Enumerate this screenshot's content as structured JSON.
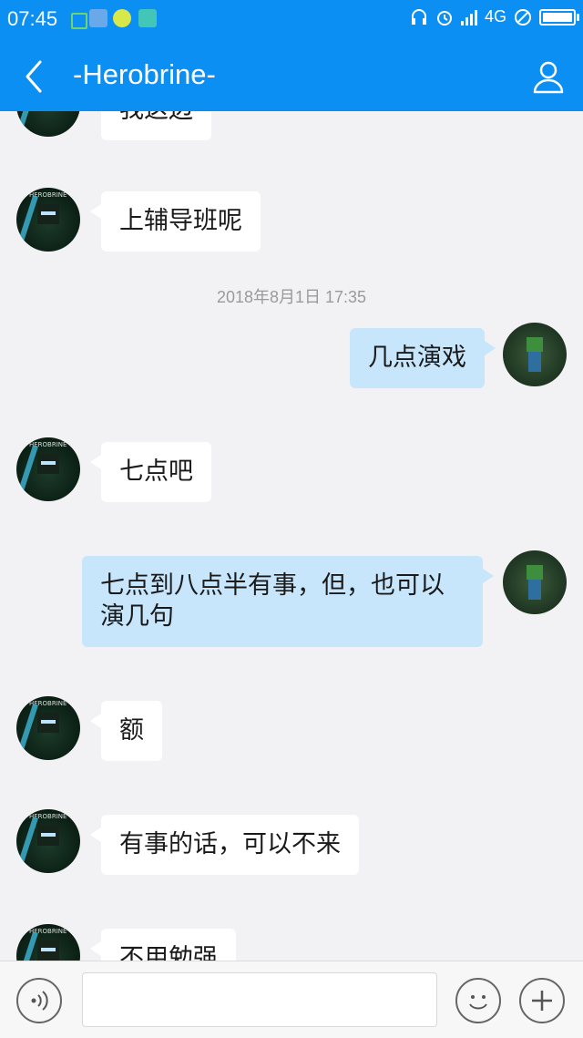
{
  "status_bar": {
    "time": "07:45",
    "network": "4G"
  },
  "nav": {
    "title": "-Herobrine-"
  },
  "messages": [
    {
      "side": "left",
      "text": "我这边"
    },
    {
      "side": "left",
      "text": "上辅导班呢"
    },
    {
      "type": "time",
      "text": "2018年8月1日 17:35"
    },
    {
      "side": "right",
      "text": "几点演戏"
    },
    {
      "side": "left",
      "text": "七点吧"
    },
    {
      "side": "right",
      "text": "七点到八点半有事，但，也可以演几句"
    },
    {
      "side": "left",
      "text": "额"
    },
    {
      "side": "left",
      "text": "有事的话，可以不来"
    },
    {
      "side": "left",
      "text": "不用勉强"
    }
  ],
  "input": {
    "value": ""
  },
  "colors": {
    "header": "#0b8ff3",
    "sent_bubble": "#c8e6fb",
    "received_bubble": "#ffffff",
    "background": "#f2f2f4"
  }
}
